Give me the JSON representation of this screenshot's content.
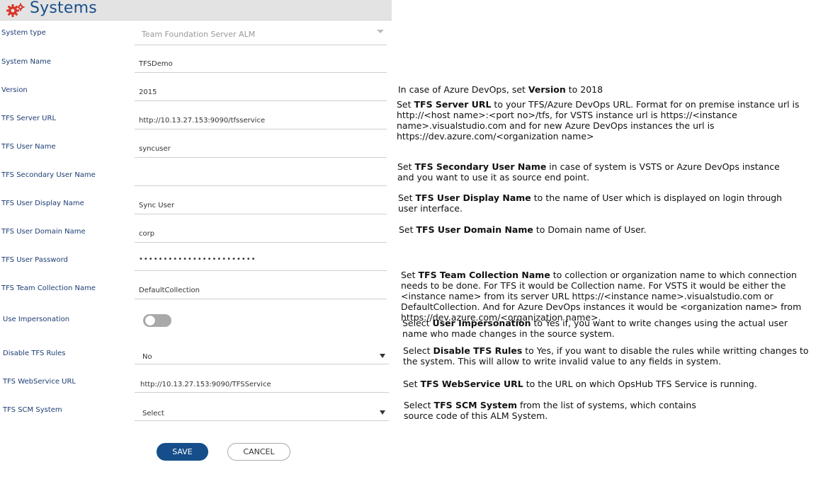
{
  "header": {
    "title": "Systems",
    "icon": "gears-icon"
  },
  "form": {
    "system_type": {
      "label": "System type",
      "placeholder": "Team Foundation Server ALM"
    },
    "system_name": {
      "label": "System Name",
      "value": "TFSDemo"
    },
    "version": {
      "label": "Version",
      "value": "2015"
    },
    "server_url": {
      "label": "TFS Server URL",
      "value": "http://10.13.27.153:9090/tfsservice"
    },
    "user_name": {
      "label": "TFS User Name",
      "value": "syncuser"
    },
    "secondary_user": {
      "label": "TFS Secondary User Name",
      "value": ""
    },
    "display_name": {
      "label": "TFS User Display Name",
      "value": "Sync User"
    },
    "domain_name": {
      "label": "TFS User Domain Name",
      "value": "corp"
    },
    "password": {
      "label": "TFS User Password",
      "value": "••••••••••••••••••••••••"
    },
    "team_collection": {
      "label": "TFS Team Collection Name",
      "value": "DefaultCollection"
    },
    "impersonation": {
      "label": "Use Impersonation",
      "state": "off"
    },
    "disable_rules": {
      "label": "Disable TFS Rules",
      "value": "No"
    },
    "webservice_url": {
      "label": "TFS WebService URL",
      "value": "http://10.13.27.153:9090/TFSService"
    },
    "scm_system": {
      "label": "TFS SCM System",
      "value": "Select"
    }
  },
  "buttons": {
    "save": "SAVE",
    "cancel": "CANCEL"
  },
  "help": {
    "version": {
      "pre": "In case of Azure DevOps, set ",
      "bold": "Version",
      "post": " to 2018"
    },
    "server_url": {
      "pre": "Set ",
      "bold": "TFS Server URL",
      "post": " to your TFS/Azure DevOps URL. Format for on premise instance url is http://<host name>:<port no>/tfs, for VSTS instance url is https://<instance name>.visualstudio.com and for new Azure DevOps instances the url is https://dev.azure.com/<organization name>"
    },
    "secondary_user": {
      "pre": "Set ",
      "bold": "TFS Secondary User Name",
      "post": " in case of system is VSTS or Azure DevOps instance and you want to use it as source end point."
    },
    "display_name": {
      "pre": "Set ",
      "bold": "TFS User Display Name",
      "post": " to the name of User which is displayed on login through user interface."
    },
    "domain_name": {
      "pre": "Set ",
      "bold": "TFS User Domain Name",
      "post": " to Domain name of User."
    },
    "team_collection": {
      "pre": "Set ",
      "bold": "TFS Team Collection Name",
      "post": " to collection or organization name to which connection needs to be done. For TFS it would be Collection name. For VSTS it would be either the <instance name> from its server URL https://<instance name>.visualstudio.com or DefaultCollection. And for Azure DevOps instances it would be <organization name> from https://dev.azure.com/<organization name>."
    },
    "impersonation": {
      "pre": "Select ",
      "bold": "User Impersonation",
      "post": " to Yes if, you want to write changes using the actual user name who made changes in the source system."
    },
    "disable_rules": {
      "pre": "Select ",
      "bold": "Disable TFS Rules",
      "post": " to Yes, if you want to disable the rules while writting changes to the system. This will allow to write invalid value to any fields in system."
    },
    "webservice_url": {
      "pre": "Set ",
      "bold": "TFS WebService URL",
      "post": " to the URL on which OpsHub TFS Service is running."
    },
    "scm_system": {
      "pre": "Select ",
      "bold": "TFS SCM System",
      "post": " from the list of systems, which contains source code of this ALM System."
    }
  },
  "colors": {
    "title": "#1a4f8a",
    "label": "#1d3d74",
    "primary_button": "#154e8a",
    "gear": "#d9362b"
  }
}
